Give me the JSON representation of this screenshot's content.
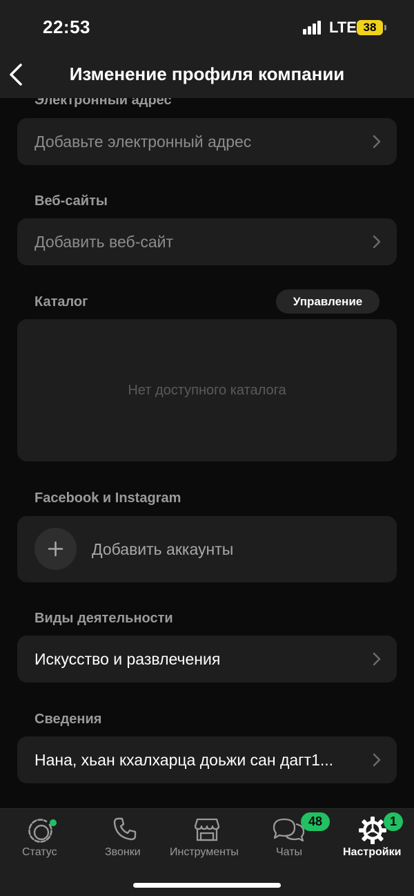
{
  "status_bar": {
    "time": "22:53",
    "network": "LTE",
    "battery": "38"
  },
  "nav": {
    "title": "Изменение профиля компании"
  },
  "sections": {
    "email": {
      "label": "Электронный адрес",
      "placeholder": "Добавьте электронный адрес"
    },
    "websites": {
      "label": "Веб-сайты",
      "placeholder": "Добавить веб-сайт"
    },
    "catalog": {
      "label": "Каталог",
      "manage_label": "Управление",
      "empty_text": "Нет доступного каталога"
    },
    "accounts": {
      "label": "Facebook и Instagram",
      "add_label": "Добавить аккаунты"
    },
    "activity": {
      "label": "Виды деятельности",
      "value": "Искусство и развлечения"
    },
    "about": {
      "label": "Сведения",
      "value": "Нана, хьан кхалхарца доьжи сан дагт1..."
    }
  },
  "tabs": [
    {
      "label": "Статус",
      "icon": "status-icon",
      "badge": ""
    },
    {
      "label": "Звонки",
      "icon": "phone-icon",
      "badge": ""
    },
    {
      "label": "Инструменты",
      "icon": "storefront-icon",
      "badge": ""
    },
    {
      "label": "Чаты",
      "icon": "chat-bubbles-icon",
      "badge": "48"
    },
    {
      "label": "Настройки",
      "icon": "gear-icon",
      "badge": "1",
      "active": true
    }
  ],
  "colors": {
    "accent_green": "#21c063",
    "battery_yellow": "#f1d21a",
    "card_bg": "#1e1e1e",
    "page_bg": "#0b0b0b"
  }
}
